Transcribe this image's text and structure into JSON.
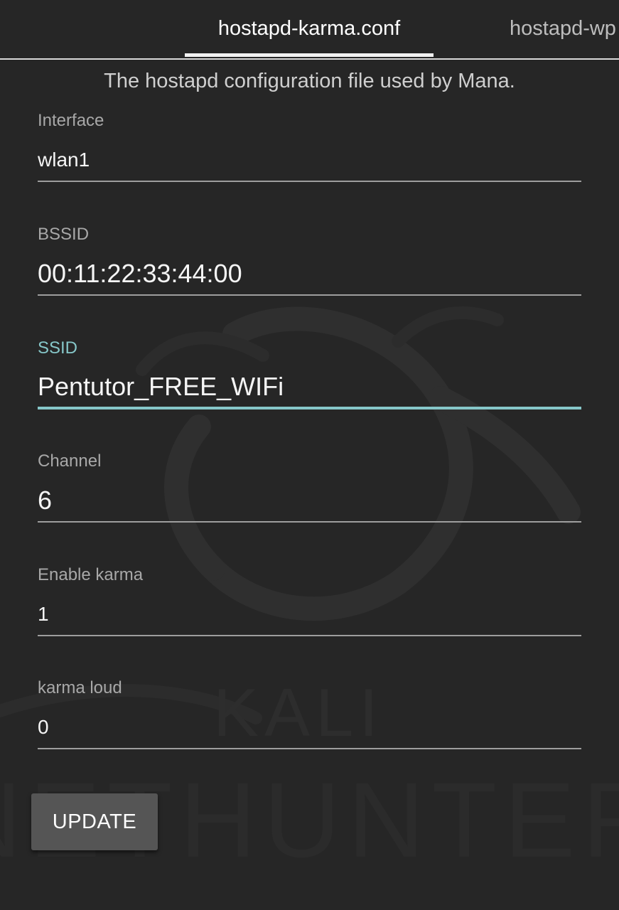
{
  "tabs": [
    {
      "label": "hostapd-karma.conf",
      "active": true
    },
    {
      "label": "hostapd-wp",
      "active": false
    }
  ],
  "description": "The hostapd configuration file used by Mana.",
  "fields": {
    "interface": {
      "label": "Interface",
      "value": "wlan1"
    },
    "bssid": {
      "label": "BSSID",
      "value": "00:11:22:33:44:00"
    },
    "ssid": {
      "label": "SSID",
      "value": "Pentutor_FREE_WIFi"
    },
    "channel": {
      "label": "Channel",
      "value": "6"
    },
    "enable_karma": {
      "label": "Enable karma",
      "value": "1"
    },
    "karma_loud": {
      "label": "karma loud",
      "value": "0"
    }
  },
  "update_button": {
    "label": "UPDATE"
  },
  "background": {
    "watermark_line1": "KALI",
    "watermark_line2": "NETHUNTER"
  },
  "colors": {
    "background": "#262626",
    "accent": "#86c7c9",
    "underline": "#9e9e9e",
    "button": "#555555"
  }
}
